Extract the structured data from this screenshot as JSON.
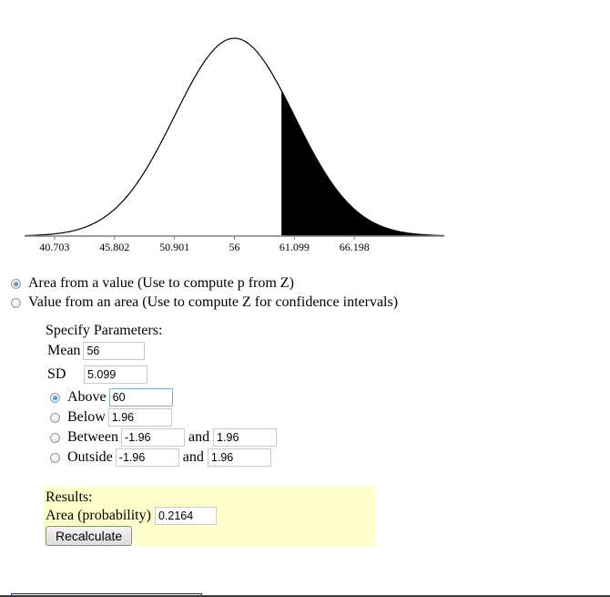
{
  "chart_data": {
    "type": "area",
    "title": "",
    "distribution": "normal",
    "mean": 56,
    "sd": 5.099,
    "xlim_sd": [
      -3.5,
      3.5
    ],
    "shaded_region": {
      "mode": "above",
      "from": 60
    },
    "tick_labels": [
      "40.703",
      "45.802",
      "50.901",
      "56",
      "61.099",
      "66.198"
    ],
    "tick_values": [
      40.703,
      45.802,
      50.901,
      56,
      61.099,
      66.198
    ],
    "xlabel": "",
    "ylabel": ""
  },
  "modes": [
    {
      "label": "Area from a value (Use to compute p from Z)",
      "checked": true
    },
    {
      "label": "Value from an area (Use to compute Z for confidence intervals)",
      "checked": false
    }
  ],
  "params": {
    "heading": "Specify Parameters:",
    "mean_label": "Mean",
    "mean_value": "56",
    "sd_label": "SD",
    "sd_value": "5.099",
    "above_label": "Above",
    "above_value": "60",
    "below_label": "Below",
    "below_value": "1.96",
    "between_label": "Between",
    "between_low": "-1.96",
    "between_and": "and",
    "between_high": "1.96",
    "outside_label": "Outside",
    "outside_low": "-1.96",
    "outside_and": "and",
    "outside_high": "1.96",
    "selected": "above"
  },
  "results": {
    "heading": "Results:",
    "area_label": "Area (probability)",
    "area_value": "0.2164",
    "recalculate_label": "Recalculate"
  }
}
